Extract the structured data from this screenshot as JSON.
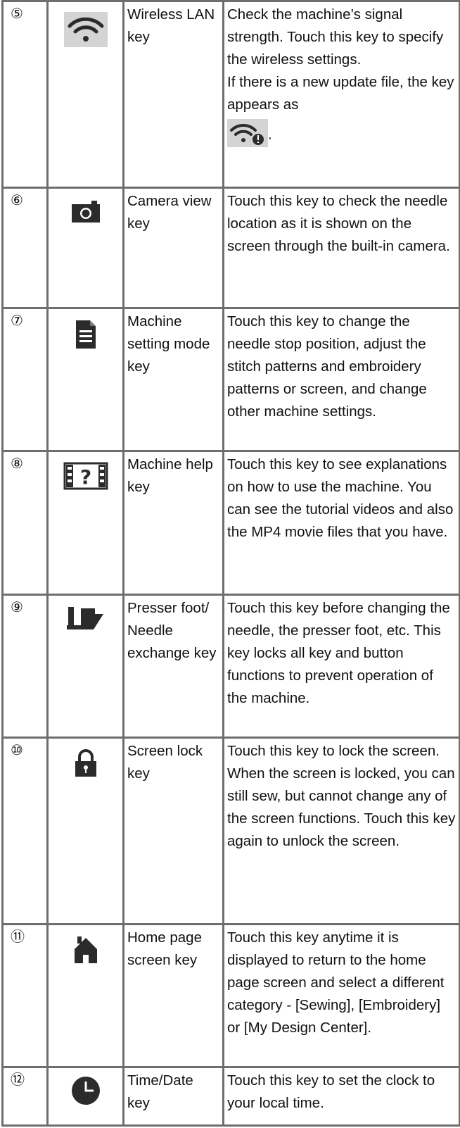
{
  "rows": [
    {
      "number": "⑤",
      "icon": "wifi-icon",
      "name": "Wireless LAN key",
      "description": "Check the machine’s signal strength. Touch this key to specify the wireless settings.",
      "description_extra": "If there is a new update file, the key appears as",
      "description_extra_icon": "wifi-update-icon",
      "description_extra_end": "."
    },
    {
      "number": "⑥",
      "icon": "camera-icon",
      "name": "Camera view key",
      "description": "Touch this key to check the needle location as it is shown on the screen through the built-in camera."
    },
    {
      "number": "⑦",
      "icon": "document-icon",
      "name": "Machine setting mode key",
      "description": "Touch this key to change the needle stop position, adjust the stitch patterns and embroidery patterns or screen, and change other machine settings."
    },
    {
      "number": "⑧",
      "icon": "film-help-icon",
      "name": "Machine help key",
      "description": "Touch this key to see explanations on how to use the machine. You can see the tutorial videos and also the MP4 movie files that you have."
    },
    {
      "number": "⑨",
      "icon": "presser-foot-icon",
      "name": "Presser foot/ Needle exchange key",
      "description": "Touch this key before changing the needle, the presser foot, etc. This key locks all key and button functions to prevent operation of the machine."
    },
    {
      "number": "⑩",
      "icon": "padlock-icon",
      "name": "Screen lock key",
      "description": "Touch this key to lock the screen. When the screen is locked, you can still sew, but cannot change any of the screen functions. Touch this key again to unlock the screen."
    },
    {
      "number": "⑪",
      "icon": "home-icon",
      "name": "Home page screen key",
      "description": "Touch this key anytime it is displayed to return to the home page screen and select a different category - [Sewing], [Embroidery] or [My Design Center]."
    },
    {
      "number": "⑫",
      "icon": "clock-icon",
      "name": "Time/Date key",
      "description": "Touch this key to set the clock to your local time."
    }
  ],
  "colors": {
    "border": "#6e6e6e",
    "icon_dark": "#2b2b2b",
    "icon_bg": "#d4d4d4"
  }
}
